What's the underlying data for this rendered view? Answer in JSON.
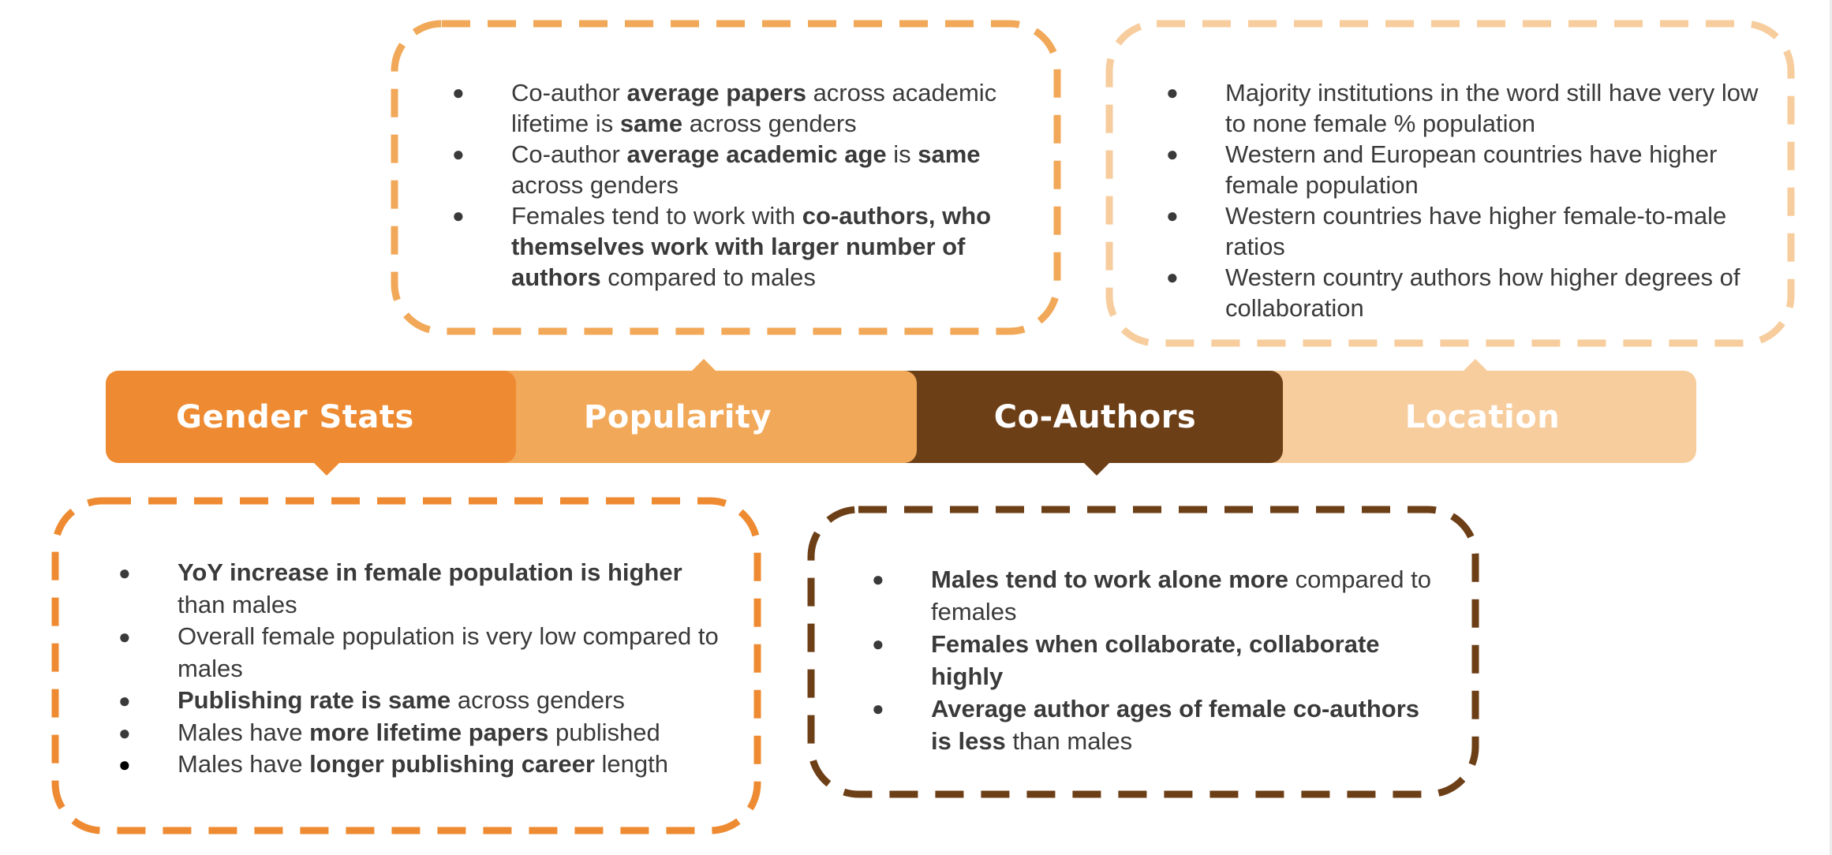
{
  "colors": {
    "gender_stats": "#EE8B32",
    "popularity": "#F1A858",
    "co_authors": "#6D3F17",
    "location": "#F7CD9E",
    "text": "#3A3A3A"
  },
  "tabs": {
    "gender_stats": "Gender Stats",
    "popularity": "Popularity",
    "co_authors": "Co-Authors",
    "location": "Location"
  },
  "popularity_box": {
    "items": [
      [
        {
          "t": "Co-author "
        },
        {
          "t": "average papers",
          "b": true
        },
        {
          "t": " across academic lifetime is "
        },
        {
          "t": "same",
          "b": true
        },
        {
          "t": " across genders"
        }
      ],
      [
        {
          "t": "Co-author "
        },
        {
          "t": "average academic age",
          "b": true
        },
        {
          "t": " is "
        },
        {
          "t": "same",
          "b": true
        },
        {
          "t": " across genders"
        }
      ],
      [
        {
          "t": "Females tend to work with "
        },
        {
          "t": "co-authors, who themselves work with larger number of authors",
          "b": true
        },
        {
          "t": " compared to males"
        }
      ]
    ]
  },
  "location_box": {
    "items": [
      [
        {
          "t": "Majority institutions in the word still have very low to none female % population"
        }
      ],
      [
        {
          "t": "Western and European countries have higher female population"
        }
      ],
      [
        {
          "t": "Western countries have higher female-to-male ratios"
        }
      ],
      [
        {
          "t": "Western country authors how higher degrees of collaboration"
        }
      ]
    ]
  },
  "gender_box": {
    "items": [
      [
        {
          "t": "YoY increase in female population is higher",
          "b": true
        },
        {
          "t": " than males"
        }
      ],
      [
        {
          "t": "Overall female population is very low compared to males"
        }
      ],
      [
        {
          "t": "Publishing rate is same",
          "b": true
        },
        {
          "t": " across genders"
        }
      ],
      [
        {
          "t": "Males have "
        },
        {
          "t": "more  lifetime papers",
          "b": true
        },
        {
          "t": " published"
        }
      ],
      [
        {
          "t": "Males have "
        },
        {
          "t": "longer publishing career",
          "b": true
        },
        {
          "t": " length"
        }
      ]
    ]
  },
  "coauthors_box": {
    "items": [
      [
        {
          "t": "Males tend to work alone more",
          "b": true
        },
        {
          "t": " compared to females"
        }
      ],
      [
        {
          "t": "Females when collaborate, collaborate highly",
          "b": true
        }
      ],
      [
        {
          "t": "Average author ages of female co-authors is less",
          "b": true
        },
        {
          "t": " than males"
        }
      ]
    ]
  }
}
